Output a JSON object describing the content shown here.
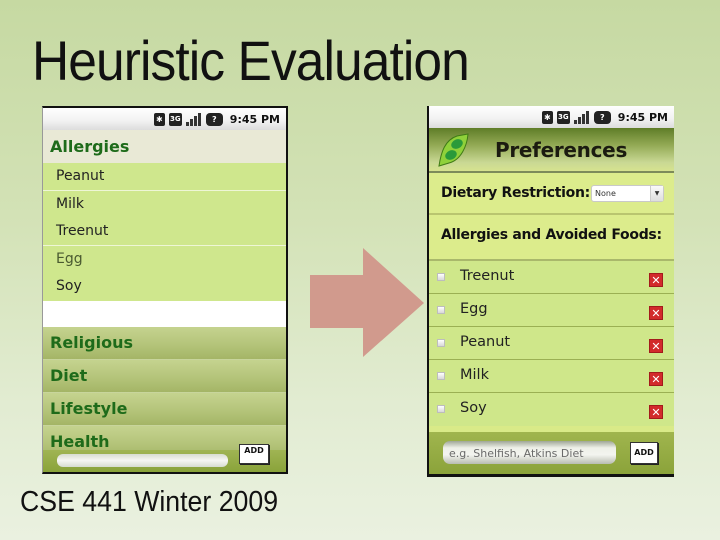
{
  "slide": {
    "title": "Heuristic Evaluation",
    "footer": "CSE 441 Winter 2009"
  },
  "colors": {
    "arrow": "#d19a8d",
    "heading_green": "#1e6b1a",
    "delete_red": "#d22b2b"
  },
  "left_phone": {
    "status_bar": {
      "icons": [
        "bluetooth-icon",
        "3g-icon",
        "signal-icon",
        "battery-icon"
      ],
      "time": "9:45 PM"
    },
    "header": "Allergies",
    "allergy_items": [
      "Peanut",
      "Milk",
      "Treenut",
      "Egg",
      "Soy"
    ],
    "categories": [
      "Religious",
      "Diet",
      "Lifestyle",
      "Health"
    ],
    "input_value": "",
    "add_label": "ADD"
  },
  "right_phone": {
    "status_bar": {
      "icons": [
        "bluetooth-icon",
        "3g-icon",
        "signal-icon",
        "battery-icon"
      ],
      "time": "9:45 PM"
    },
    "title": "Preferences",
    "logo": "pea-pod-leaf-icon",
    "dietary_restriction": {
      "label": "Dietary Restriction:",
      "selected": "None"
    },
    "allergies_heading": "Allergies and Avoided Foods:",
    "items": [
      {
        "label": "Treenut",
        "checked": false
      },
      {
        "label": "Egg",
        "checked": false
      },
      {
        "label": "Peanut",
        "checked": false
      },
      {
        "label": "Milk",
        "checked": false
      },
      {
        "label": "Soy",
        "checked": false
      }
    ],
    "delete_glyph": "✕",
    "input_placeholder": "e.g. Shelfish, Atkins Diet",
    "add_label": "ADD"
  }
}
